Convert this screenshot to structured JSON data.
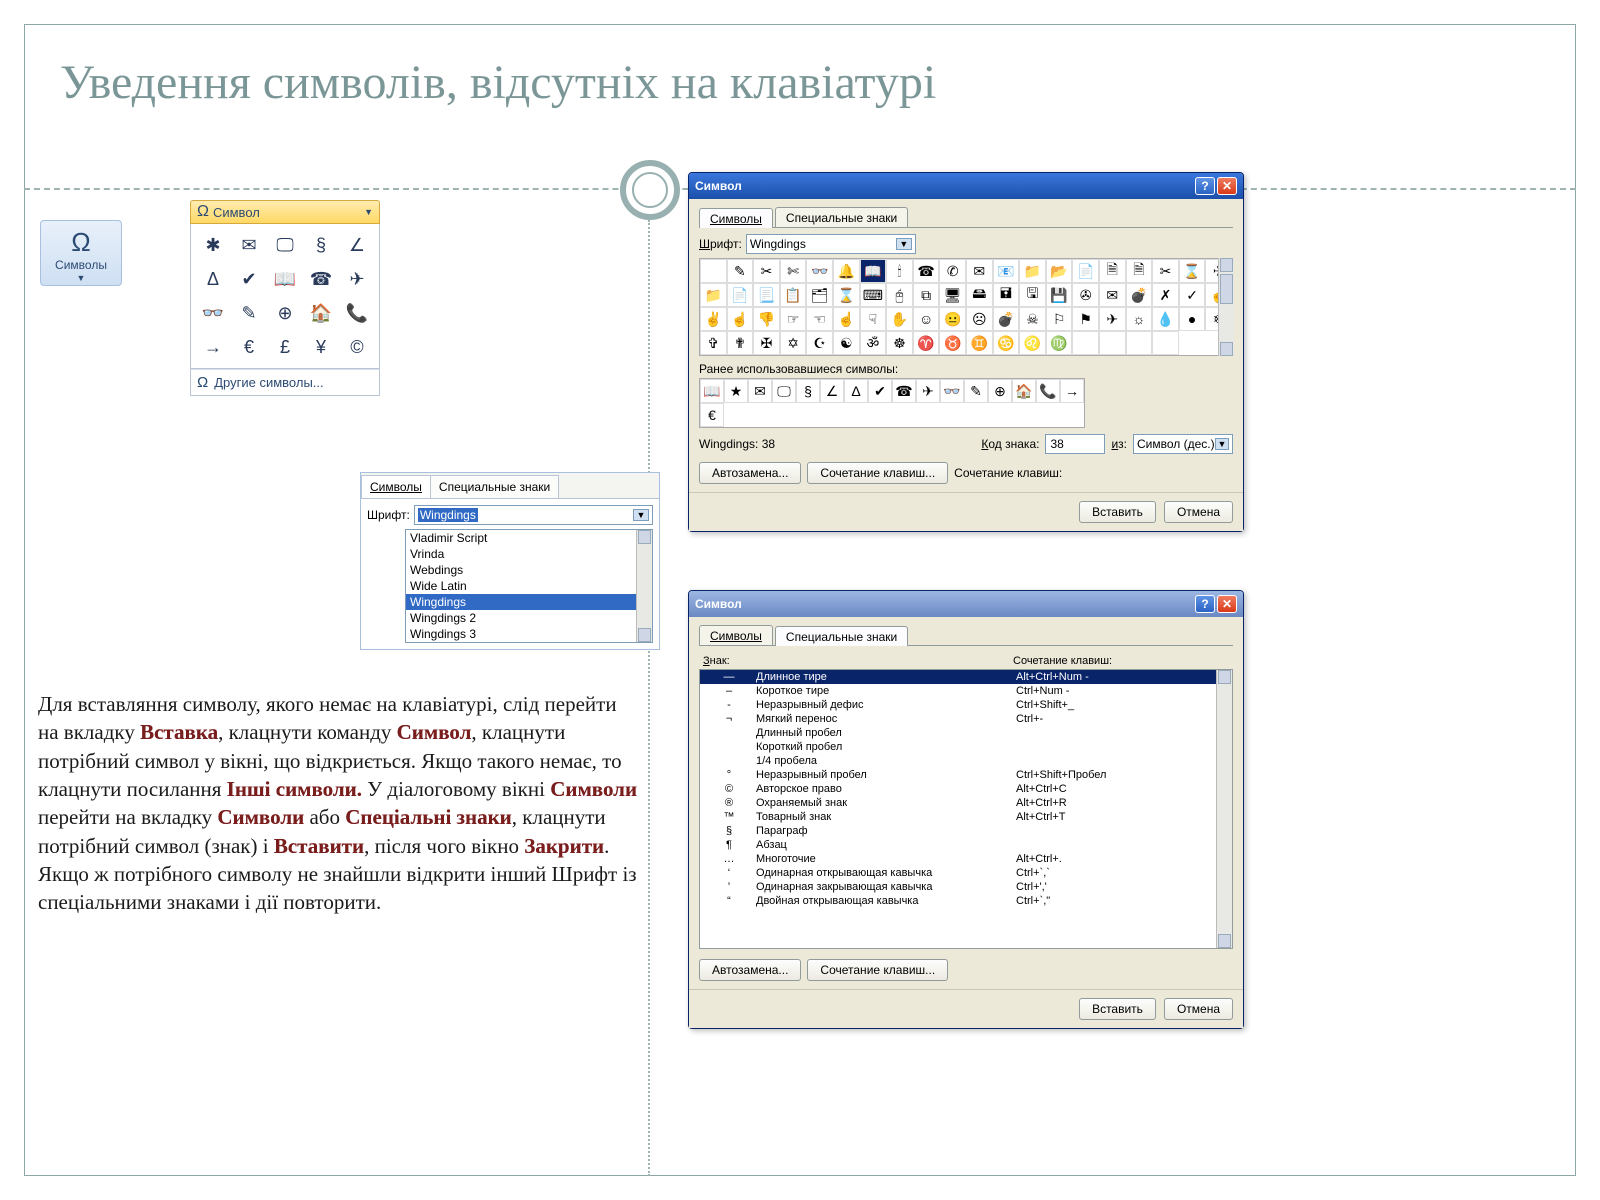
{
  "slide": {
    "title": "Уведення символів, відсутніх на клавіатурі"
  },
  "ribbon": {
    "symbols_big_label": "Символы",
    "symbol_dd_label": "Символ",
    "more_symbols": "Другие символы..."
  },
  "ribbon_symbols": [
    "✱",
    "✉",
    "🖵",
    "§",
    "∠",
    "Δ",
    "✔",
    "📖",
    "☎",
    "✈",
    "👓",
    "✎",
    "⊕",
    "🏠",
    "📞",
    "→",
    "€",
    "£",
    "¥",
    "©"
  ],
  "font_snippet": {
    "tab_symbols": "Символы",
    "tab_special": "Специальные знаки",
    "font_label": "Шрифт:",
    "font_value": "Wingdings",
    "fonts": [
      "Vladimir Script",
      "Vrinda",
      "Webdings",
      "Wide Latin",
      "Wingdings",
      "Wingdings 2",
      "Wingdings 3"
    ],
    "selected_font_index": 4
  },
  "paragraph": {
    "t1": "Для вставляння символу, якого немає на клавіатурі, слід перейти на вкладку ",
    "k1": "Вставка",
    "t2": ", клацнути команду ",
    "k2": "Символ",
    "t3": ", клацнути потрібний символ у вікні, що відкриється. Якщо такого немає, то клацнути посилання ",
    "k3": "Інші символи.",
    "t4": " У діалоговому вікні ",
    "k4": "Символи",
    "t5": "  перейти на вкладку ",
    "k5": "Символи",
    "t6": " або ",
    "k6": "Спеціальні знаки",
    "t7": ", клацнути потрібний символ (знак) і ",
    "k7": "Вставити",
    "t8": ", після чого вікно ",
    "k8": "Закрити",
    "t9": ". Якщо ж  потрібного символу не знайшли відкрити  інший Шрифт із спеціальними знаками і дії повторити."
  },
  "dlg1": {
    "title": "Символ",
    "tab_symbols": "Символы",
    "tab_special": "Специальные знаки",
    "font_label": "Шрифт:",
    "font_value": "Wingdings",
    "recent_label": "Ранее использовавшиеся символы:",
    "status_left": "Wingdings: 38",
    "code_label": "Код знака:",
    "code_value": "38",
    "from_label": "из:",
    "from_value": "Символ (дес.)",
    "btn_autocorrect": "Автозамена...",
    "btn_shortcut": "Сочетание клавиш...",
    "shortcut_lbl": "Сочетание клавиш:",
    "btn_insert": "Вставить",
    "btn_cancel": "Отмена"
  },
  "dlg1_grid": [
    "",
    "✎",
    "✂",
    "✄",
    "👓",
    "🔔",
    "📖",
    "🕯",
    "☎",
    "✆",
    "✉",
    "📧",
    "📁",
    "📂",
    "📄",
    "🗎",
    "🗎",
    "✂",
    "⌛",
    "✈",
    "📁",
    "📄",
    "📃",
    "📋",
    "🗂",
    "⌛",
    "⌨",
    "🖰",
    "⧉",
    "🖥",
    "🖴",
    "🖬",
    "🖫",
    "💾",
    "✇",
    "✉",
    "💣",
    "✗",
    "✓",
    "☝",
    "✌",
    "☝",
    "👎",
    "☞",
    "☜",
    "☝",
    "☟",
    "✋",
    "☺",
    "😐",
    "☹",
    "💣",
    "☠",
    "⚐",
    "⚑",
    "✈",
    "☼",
    "💧",
    "●",
    "❄",
    "✞",
    "✟",
    "✠",
    "✡",
    "☪",
    "☯",
    "ॐ",
    "☸",
    "♈",
    "♉",
    "♊",
    "♋",
    "♌",
    "♍",
    "",
    "",
    "",
    ""
  ],
  "dlg1_recent": [
    "📖",
    "★",
    "✉",
    "🖵",
    "§",
    "∠",
    "Δ",
    "✔",
    "☎",
    "✈",
    "👓",
    "✎",
    "⊕",
    "🏠",
    "📞",
    "→",
    "€"
  ],
  "dlg2": {
    "title": "Символ",
    "tab_symbols": "Символы",
    "tab_special": "Специальные знаки",
    "head_sign": "Знак:",
    "head_shortcut": "Сочетание клавиш:",
    "btn_autocorrect": "Автозамена...",
    "btn_shortcut": "Сочетание клавиш...",
    "btn_insert": "Вставить",
    "btn_cancel": "Отмена"
  },
  "dlg2_rows": [
    {
      "sym": "—",
      "name": "Длинное тире",
      "key": "Alt+Ctrl+Num -",
      "sel": true
    },
    {
      "sym": "–",
      "name": "Короткое тире",
      "key": "Ctrl+Num -"
    },
    {
      "sym": "-",
      "name": "Неразрывный дефис",
      "key": "Ctrl+Shift+_"
    },
    {
      "sym": "¬",
      "name": "Мягкий перенос",
      "key": "Ctrl+-"
    },
    {
      "sym": "",
      "name": "Длинный пробел",
      "key": ""
    },
    {
      "sym": "",
      "name": "Короткий пробел",
      "key": ""
    },
    {
      "sym": "",
      "name": "1/4 пробела",
      "key": ""
    },
    {
      "sym": "°",
      "name": "Неразрывный пробел",
      "key": "Ctrl+Shift+Пробел"
    },
    {
      "sym": "©",
      "name": "Авторское право",
      "key": "Alt+Ctrl+C"
    },
    {
      "sym": "®",
      "name": "Охраняемый знак",
      "key": "Alt+Ctrl+R"
    },
    {
      "sym": "™",
      "name": "Товарный знак",
      "key": "Alt+Ctrl+T"
    },
    {
      "sym": "§",
      "name": "Параграф",
      "key": ""
    },
    {
      "sym": "¶",
      "name": "Абзац",
      "key": ""
    },
    {
      "sym": "…",
      "name": "Многоточие",
      "key": "Alt+Ctrl+."
    },
    {
      "sym": "‘",
      "name": "Одинарная открывающая кавычка",
      "key": "Ctrl+`,`"
    },
    {
      "sym": "’",
      "name": "Одинарная закрывающая кавычка",
      "key": "Ctrl+',' "
    },
    {
      "sym": "“",
      "name": "Двойная открывающая кавычка",
      "key": "Ctrl+`,\""
    }
  ]
}
